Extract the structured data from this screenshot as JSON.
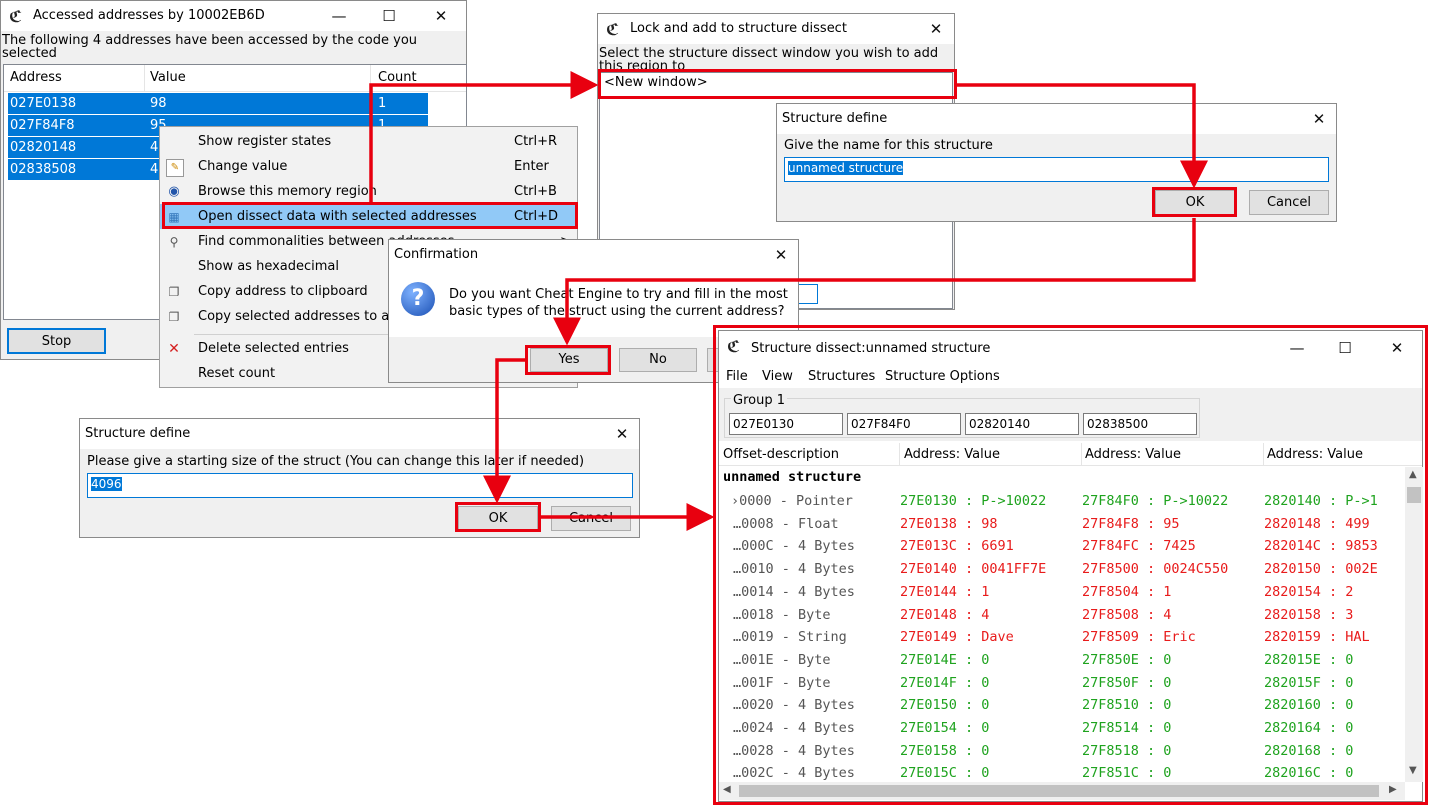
{
  "accessed_window": {
    "title": "Accessed addresses by 10002EB6D",
    "message": "The following 4 addresses have been accessed by the code you selected",
    "columns": [
      "Address",
      "Value",
      "Count"
    ],
    "rows": [
      {
        "address": "027E0138",
        "value": "98",
        "count": "1"
      },
      {
        "address": "027F84F8",
        "value": "95",
        "count": "1"
      },
      {
        "address": "02820148",
        "value": "49",
        "count": ""
      },
      {
        "address": "02838508",
        "value": "4",
        "count": ""
      }
    ],
    "stop_label": "Stop"
  },
  "context_menu": {
    "items": [
      {
        "label": "Show register states",
        "shortcut": "Ctrl+R",
        "icon": ""
      },
      {
        "label": "Change value",
        "shortcut": "Enter",
        "icon": "edit-icon"
      },
      {
        "label": "Browse this memory region",
        "shortcut": "Ctrl+B",
        "icon": "binoculars-icon"
      },
      {
        "label": "Open dissect data with selected addresses",
        "shortcut": "Ctrl+D",
        "icon": "dissect-icon"
      },
      {
        "label": "Find commonalities between addresses",
        "shortcut": ">",
        "icon": "magnifier-icon"
      },
      {
        "label": "Show as hexadecimal",
        "shortcut": "",
        "icon": ""
      },
      {
        "label": "Copy address to clipboard",
        "shortcut": "",
        "icon": "copy-icon"
      },
      {
        "label": "Copy selected addresses to address list",
        "shortcut": "",
        "icon": "copy-icon"
      },
      {
        "label": "Delete selected entries",
        "shortcut": "",
        "icon": "delete-icon"
      },
      {
        "label": "Reset count",
        "shortcut": "",
        "icon": ""
      }
    ]
  },
  "lock_window": {
    "title": "Lock and add to structure dissect",
    "message": "Select the structure dissect window you wish to add this region to",
    "list_item": "<New window>"
  },
  "structure_define_name": {
    "title": "Structure define",
    "prompt": "Give the name for this structure",
    "value": "unnamed structure",
    "ok_label": "OK",
    "cancel_label": "Cancel"
  },
  "confirmation": {
    "title": "Confirmation",
    "message_line1": "Do you want Cheat Engine to try and fill in the most",
    "message_line2": "basic types of the struct using the current address?",
    "yes_label": "Yes",
    "no_label": "No"
  },
  "structure_define_size": {
    "title": "Structure define",
    "prompt": "Please give a starting size of the struct (You can change this later if needed)",
    "value": "4096",
    "ok_label": "OK",
    "cancel_label": "Cancel"
  },
  "dissect_window": {
    "title": "Structure dissect:unnamed structure",
    "menu": [
      "File",
      "View",
      "Structures",
      "Structure Options"
    ],
    "group_label": "Group 1",
    "group_addresses": [
      "027E0130",
      "027F84F0",
      "02820140",
      "02838500"
    ],
    "columns": [
      "Offset-description",
      "Address: Value",
      "Address: Value",
      "Address: Value"
    ],
    "root_label": "unnamed structure",
    "rows": [
      {
        "offset": "0000",
        "type": "Pointer",
        "color": "green",
        "cells": [
          "27E0130 : P->10022",
          "27F84F0 : P->10022",
          "2820140 : P->1"
        ]
      },
      {
        "offset": "0008",
        "type": "Float",
        "color": "red",
        "cells": [
          "27E0138 : 98",
          "27F84F8 : 95",
          "2820148 : 499"
        ]
      },
      {
        "offset": "000C",
        "type": "4 Bytes",
        "color": "red",
        "cells": [
          "27E013C : 6691",
          "27F84FC : 7425",
          "282014C : 9853"
        ]
      },
      {
        "offset": "0010",
        "type": "4 Bytes",
        "color": "red",
        "cells": [
          "27E0140 : 0041FF7E",
          "27F8500 : 0024C550",
          "2820150 : 002E"
        ]
      },
      {
        "offset": "0014",
        "type": "4 Bytes",
        "color": "red",
        "cells": [
          "27E0144 : 1",
          "27F8504 : 1",
          "2820154 : 2"
        ]
      },
      {
        "offset": "0018",
        "type": "Byte",
        "color": "red",
        "cells": [
          "27E0148 : 4",
          "27F8508 : 4",
          "2820158 : 3"
        ]
      },
      {
        "offset": "0019",
        "type": "String",
        "color": "red",
        "cells": [
          "27E0149 : Dave",
          "27F8509 : Eric",
          "2820159 : HAL"
        ]
      },
      {
        "offset": "001E",
        "type": "Byte",
        "color": "green",
        "cells": [
          "27E014E : 0",
          "27F850E : 0",
          "282015E : 0"
        ]
      },
      {
        "offset": "001F",
        "type": "Byte",
        "color": "green",
        "cells": [
          "27E014F : 0",
          "27F850F : 0",
          "282015F : 0"
        ]
      },
      {
        "offset": "0020",
        "type": "4 Bytes",
        "color": "green",
        "cells": [
          "27E0150 : 0",
          "27F8510 : 0",
          "2820160 : 0"
        ]
      },
      {
        "offset": "0024",
        "type": "4 Bytes",
        "color": "green",
        "cells": [
          "27E0154 : 0",
          "27F8514 : 0",
          "2820164 : 0"
        ]
      },
      {
        "offset": "0028",
        "type": "4 Bytes",
        "color": "green",
        "cells": [
          "27E0158 : 0",
          "27F8518 : 0",
          "2820168 : 0"
        ]
      },
      {
        "offset": "002C",
        "type": "4 Bytes",
        "color": "green",
        "cells": [
          "27E015C : 0",
          "27F851C : 0",
          "282016C : 0"
        ]
      }
    ]
  },
  "colors": {
    "highlight": "#e8000f",
    "selection": "#0078d7",
    "value_green": "#1ea31e",
    "value_red": "#e81b1b"
  }
}
